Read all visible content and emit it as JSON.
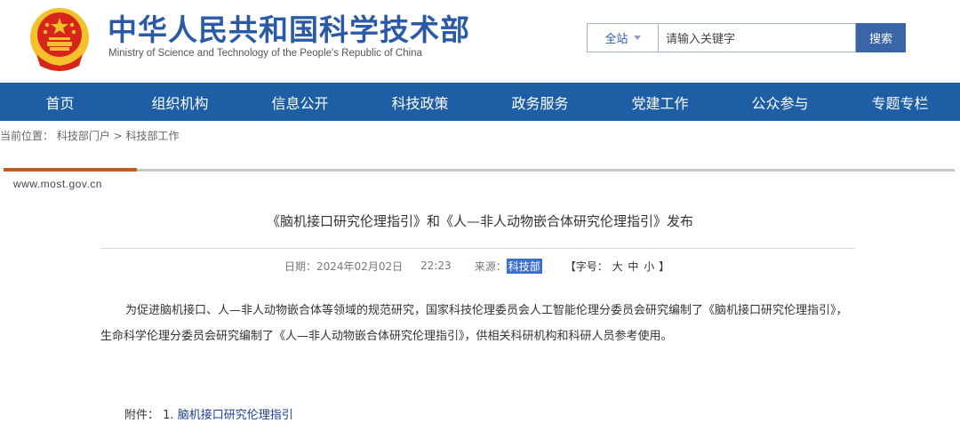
{
  "header": {
    "title": "中华人民共和国科学技术部",
    "subtitle": "Ministry of Science and Technology of the People's Republic of China",
    "colors": {
      "title": "#2a5aa6",
      "emblem_red": "#d8251c",
      "emblem_gold": "#f4c12a"
    }
  },
  "search": {
    "scope": "全站",
    "placeholder": "请输入关键字",
    "button": "搜索"
  },
  "nav": {
    "color": "#1d5ea5",
    "items": [
      "首页",
      "组织机构",
      "信息公开",
      "科技政策",
      "政务服务",
      "党建工作",
      "公众参与",
      "专题专栏"
    ]
  },
  "breadcrumb": {
    "label": "当前位置：",
    "items": [
      "科技部门户",
      "科技部工作"
    ],
    "separator": " > "
  },
  "article": {
    "site_url": "www.most.gov.cn",
    "title": "《脑机接口研究伦理指引》和《人—非人动物嵌合体研究伦理指引》发布",
    "date_label": "日期：",
    "date_value": "2024年02月02日",
    "time_value": "22:23",
    "source_label": "来源：",
    "source_value": "科技部",
    "fontsize_label": "【字号：",
    "fontsize_options": [
      "大",
      "中",
      "小"
    ],
    "fontsize_end": "】",
    "paragraph": "为促进脑机接口、人—非人动物嵌合体等领域的规范研究，国家科技伦理委员会人工智能伦理分委员会研究编制了《脑机接口研究伦理指引》，生命科学伦理分委员会研究编制了《人—非人动物嵌合体研究伦理指引》，供相关科研机构和科研人员参考使用。",
    "attachment_label": "附件：",
    "attachments": [
      {
        "index": "1.",
        "title": "脑机接口研究伦理指引"
      }
    ]
  }
}
